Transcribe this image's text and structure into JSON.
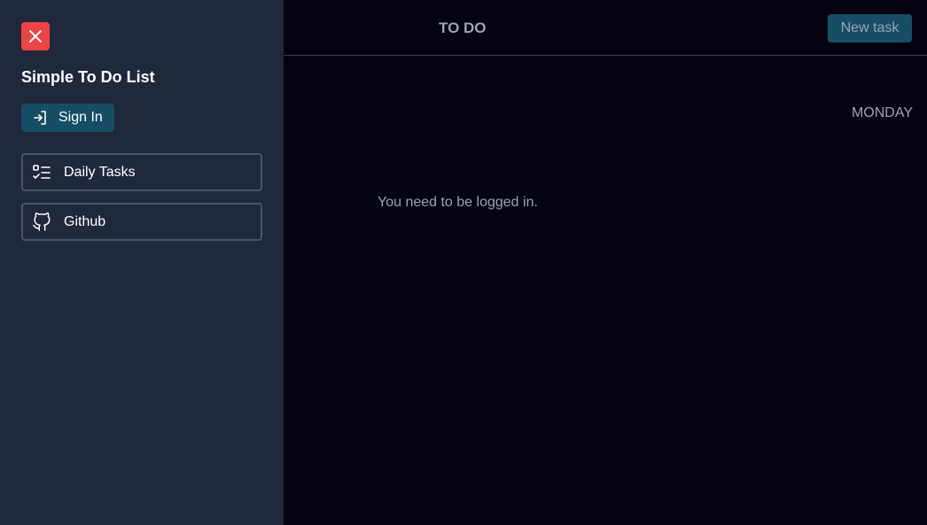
{
  "sidebar": {
    "close_icon": "close-icon",
    "title": "Simple To Do List",
    "sign_in_label": "Sign In",
    "sign_in_icon": "sign-in-icon",
    "items": [
      {
        "label": "Daily Tasks",
        "icon": "checklist-icon"
      },
      {
        "label": "Github",
        "icon": "github-icon"
      }
    ]
  },
  "header": {
    "title": "TO DO",
    "new_task_label": "New task"
  },
  "main": {
    "day": "MONDAY",
    "message": "You need to be logged in."
  },
  "colors": {
    "sidebar_bg": "#1f293b",
    "main_bg": "#03040f",
    "close_button": "#ef4444",
    "accent_button": "#164e63",
    "muted_text": "#9ca3af"
  }
}
